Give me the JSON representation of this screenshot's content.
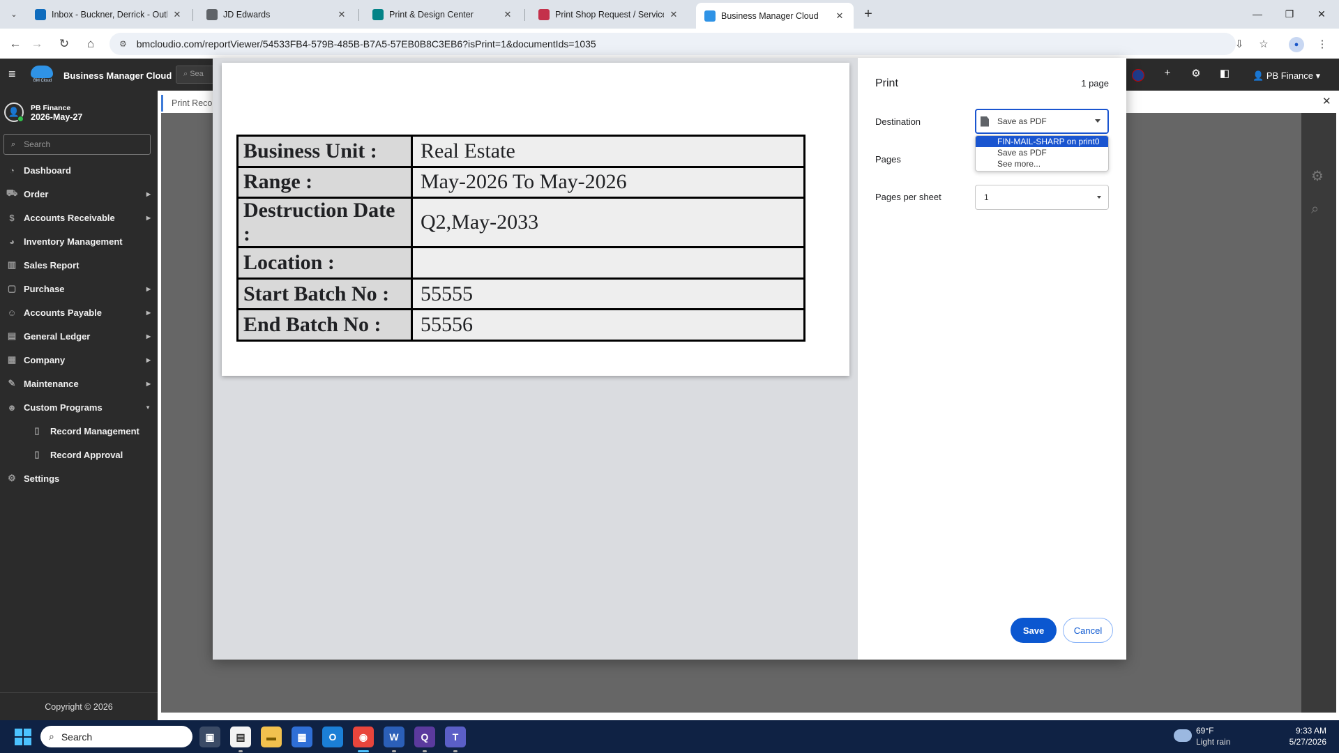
{
  "browser": {
    "tabs": [
      {
        "title": "Inbox - Buckner, Derrick - Outlo",
        "favicon": "outlook-icon",
        "color": "#0f6cbd"
      },
      {
        "title": "JD Edwards",
        "favicon": "globe-icon",
        "color": "#5f6368"
      },
      {
        "title": "Print & Design Center",
        "favicon": "sharepoint-icon",
        "color": "#038387"
      },
      {
        "title": "Print Shop Request / Service Ca",
        "favicon": "forms-icon",
        "color": "#c4314b"
      },
      {
        "title": "Business Manager Cloud",
        "favicon": "bmcloud-icon",
        "color": "#2f93e6"
      }
    ],
    "url": "bmcloudio.com/reportViewer/54533FB4-579B-485B-B7A5-57EB0B8C3EB6?isPrint=1&documentIds=1035"
  },
  "app": {
    "title": "Business Manager Cloud",
    "logo_text": "BM Cloud",
    "search_placeholder": "Sea",
    "user_menu": "PB Finance"
  },
  "sidebar": {
    "username": "PB Finance",
    "date": "2026-May-27",
    "search_placeholder": "Search",
    "items": [
      {
        "label": "Dashboard",
        "icon": "dashboard-icon",
        "glyph": "◔",
        "chevron": false
      },
      {
        "label": "Order",
        "icon": "cart-icon",
        "glyph": "⛟",
        "chevron": true
      },
      {
        "label": "Accounts Receivable",
        "icon": "dollar-icon",
        "glyph": "$",
        "chevron": true
      },
      {
        "label": "Inventory Management",
        "icon": "gauge-icon",
        "glyph": "◕",
        "chevron": false
      },
      {
        "label": "Sales Report",
        "icon": "bar-chart-icon",
        "glyph": "▥",
        "chevron": false
      },
      {
        "label": "Purchase",
        "icon": "bag-icon",
        "glyph": "▢",
        "chevron": true
      },
      {
        "label": "Accounts Payable",
        "icon": "users-icon",
        "glyph": "☺",
        "chevron": true
      },
      {
        "label": "General Ledger",
        "icon": "book-icon",
        "glyph": "▤",
        "chevron": true
      },
      {
        "label": "Company",
        "icon": "building-icon",
        "glyph": "▦",
        "chevron": true
      },
      {
        "label": "Maintenance",
        "icon": "wrench-icon",
        "glyph": "✎",
        "chevron": true
      },
      {
        "label": "Custom Programs",
        "icon": "people-icon",
        "glyph": "☻",
        "chevron": true,
        "expanded": true
      },
      {
        "label": "Record Management",
        "icon": "file-icon",
        "glyph": "▯",
        "chevron": false,
        "sub": true
      },
      {
        "label": "Record Approval",
        "icon": "file-icon",
        "glyph": "▯",
        "chevron": false,
        "sub": true
      },
      {
        "label": "Settings",
        "icon": "gear-icon",
        "glyph": "⚙",
        "chevron": false
      }
    ],
    "copyright": "Copyright © 2026"
  },
  "main": {
    "tab_label": "Print Reco"
  },
  "print_preview": {
    "rows": [
      {
        "label": "Business Unit :",
        "value": "Real Estate"
      },
      {
        "label": "Range :",
        "value": "May-2026 To May-2026"
      },
      {
        "label": "Destruction Date :",
        "value": "Q2,May-2033"
      },
      {
        "label": "Location :",
        "value": ""
      },
      {
        "label": "Start Batch No :",
        "value": "55555"
      },
      {
        "label": "End Batch No :",
        "value": "55556"
      }
    ]
  },
  "print_settings": {
    "title": "Print",
    "page_count": "1 page",
    "destination_label": "Destination",
    "destination_value": "Save as PDF",
    "destination_options": [
      "FIN-MAIL-SHARP on print0",
      "Save as PDF",
      "See more..."
    ],
    "pages_label": "Pages",
    "pages_per_sheet_label": "Pages per sheet",
    "pages_per_sheet_value": "1",
    "save_label": "Save",
    "cancel_label": "Cancel"
  },
  "taskbar": {
    "search_placeholder": "Search",
    "weather_temp": "69°F",
    "weather_desc": "Light rain",
    "time": "9:33 AM",
    "date": "5/27/2026"
  }
}
